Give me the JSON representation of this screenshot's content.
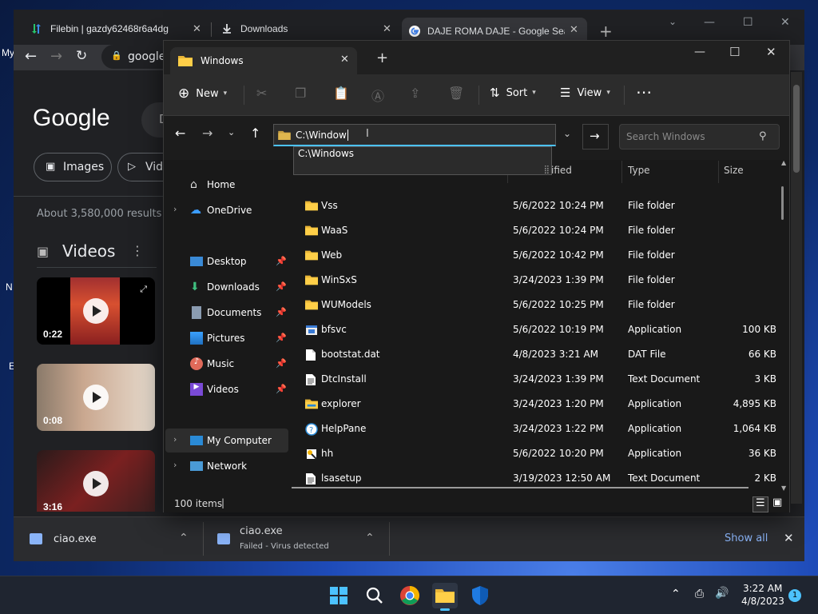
{
  "desktop": {
    "left_labels": [
      "My",
      "N",
      "E"
    ]
  },
  "chrome": {
    "tabs": [
      {
        "label": "Filebin | gazdy62468r6a4dg",
        "icon": "filebin-icon"
      },
      {
        "label": "Downloads",
        "icon": "download-icon"
      },
      {
        "label": "DAJE ROMA DAJE - Google Sear",
        "icon": "google-icon"
      }
    ],
    "url_partial": "google",
    "google": {
      "logo": "Google",
      "search_partial": "D",
      "chips": [
        "Images",
        "Vid"
      ],
      "results_count": "About 3,580,000 results",
      "videos_heading": "Videos",
      "videos": [
        {
          "duration": "0:22"
        },
        {
          "duration": "0:08"
        },
        {
          "duration": "3:16"
        }
      ]
    },
    "downloads_bar": {
      "items": [
        {
          "name": "ciao.exe",
          "status": ""
        },
        {
          "name": "ciao.exe",
          "status": "Failed - Virus detected"
        }
      ],
      "show_all": "Show all"
    }
  },
  "explorer": {
    "tab_title": "Windows",
    "commands": {
      "new": "New",
      "sort": "Sort",
      "view": "View"
    },
    "address_value": "C:\\Window",
    "suggestion": "C:\\Windows",
    "search_placeholder": "Search Windows",
    "nav": {
      "home": "Home",
      "onedrive": "OneDrive",
      "quick": [
        {
          "label": "Desktop",
          "icon": "desktop-icon"
        },
        {
          "label": "Downloads",
          "icon": "download-icon"
        },
        {
          "label": "Documents",
          "icon": "document-icon"
        },
        {
          "label": "Pictures",
          "icon": "pictures-icon"
        },
        {
          "label": "Music",
          "icon": "music-icon"
        },
        {
          "label": "Videos",
          "icon": "videos-icon"
        }
      ],
      "my_computer": "My Computer",
      "network": "Network"
    },
    "columns": {
      "modified_partial": "ified",
      "type": "Type",
      "size": "Size"
    },
    "files": [
      {
        "name": "Vss",
        "date": "5/6/2022 10:24 PM",
        "type": "File folder",
        "size": "",
        "icon": "folder-icon"
      },
      {
        "name": "WaaS",
        "date": "5/6/2022 10:24 PM",
        "type": "File folder",
        "size": "",
        "icon": "folder-icon"
      },
      {
        "name": "Web",
        "date": "5/6/2022 10:42 PM",
        "type": "File folder",
        "size": "",
        "icon": "folder-icon"
      },
      {
        "name": "WinSxS",
        "date": "3/24/2023 1:39 PM",
        "type": "File folder",
        "size": "",
        "icon": "folder-icon"
      },
      {
        "name": "WUModels",
        "date": "5/6/2022 10:25 PM",
        "type": "File folder",
        "size": "",
        "icon": "folder-icon"
      },
      {
        "name": "bfsvc",
        "date": "5/6/2022 10:19 PM",
        "type": "Application",
        "size": "100 KB",
        "icon": "app-icon"
      },
      {
        "name": "bootstat.dat",
        "date": "4/8/2023 3:21 AM",
        "type": "DAT File",
        "size": "66 KB",
        "icon": "file-icon"
      },
      {
        "name": "DtcInstall",
        "date": "3/24/2023 1:39 PM",
        "type": "Text Document",
        "size": "3 KB",
        "icon": "text-file-icon"
      },
      {
        "name": "explorer",
        "date": "3/24/2023 1:20 PM",
        "type": "Application",
        "size": "4,895 KB",
        "icon": "explorer-icon"
      },
      {
        "name": "HelpPane",
        "date": "3/24/2023 1:22 PM",
        "type": "Application",
        "size": "1,064 KB",
        "icon": "help-icon"
      },
      {
        "name": "hh",
        "date": "5/6/2022 10:20 PM",
        "type": "Application",
        "size": "36 KB",
        "icon": "hh-icon"
      },
      {
        "name": "lsasetup",
        "date": "3/19/2023 12:50 AM",
        "type": "Text Document",
        "size": "2 KB",
        "icon": "text-file-icon"
      }
    ],
    "status_items": "100 items"
  },
  "taskbar": {
    "time": "3:22 AM",
    "date": "4/8/2023",
    "notifications": "1"
  }
}
